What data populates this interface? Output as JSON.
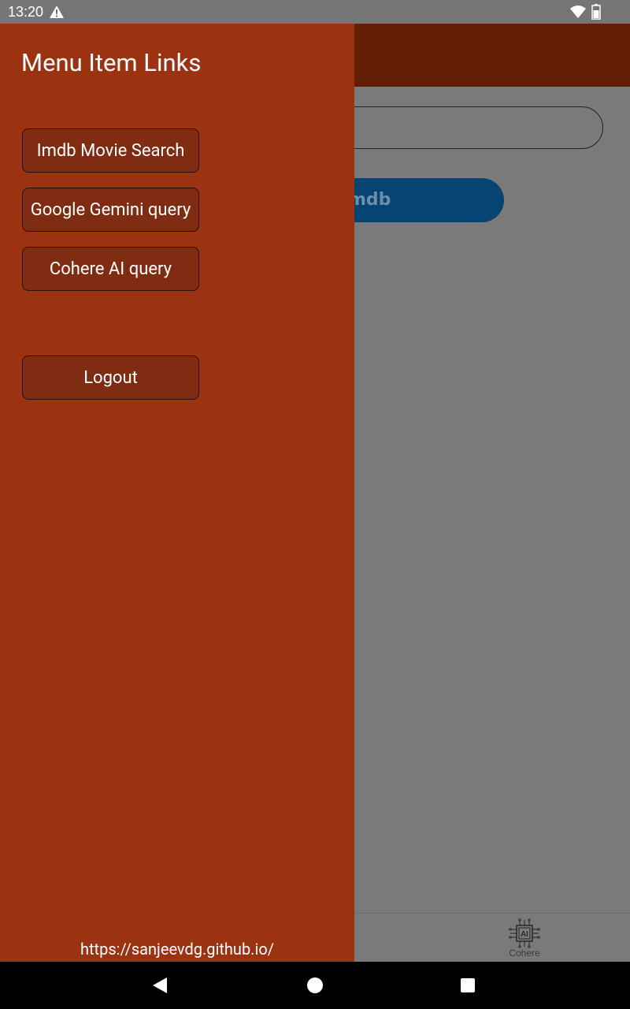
{
  "status_bar": {
    "time": "13:20",
    "icons": [
      "warning-icon",
      "wifi-icon",
      "battery-icon"
    ]
  },
  "background_app": {
    "search_button_label": "Imdb",
    "search_button_visible_text": "mdb",
    "bottom_nav": {
      "items": [
        {
          "label": "Cohere",
          "icon": "ai-chip-icon",
          "icon_text": "AI"
        }
      ]
    }
  },
  "drawer": {
    "title": "Menu Item Links",
    "buttons": [
      {
        "label": "Imdb Movie Search"
      },
      {
        "label": "Google Gemini query"
      },
      {
        "label": "Cohere AI query"
      }
    ],
    "logout_label": "Logout",
    "footer_link": "https://sanjeevdg.github.io/"
  },
  "colors": {
    "drawer_bg": "#9b3312",
    "drawer_button_bg": "#7f2c12",
    "toolbar_bg": "#621f06",
    "imdb_button_bg": "#064473",
    "scrim": "#7a7a7a"
  },
  "system_nav": {
    "icons": [
      "back-icon",
      "home-icon",
      "recents-icon"
    ]
  }
}
